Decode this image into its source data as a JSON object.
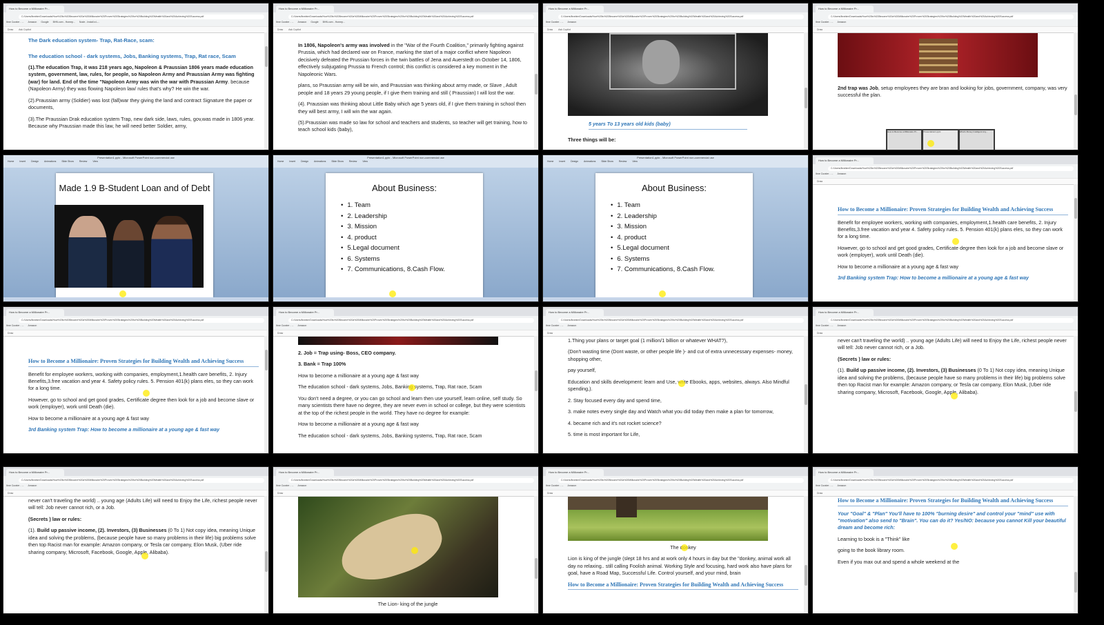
{
  "browser": {
    "tab_title": "How to Become a Millionaire Pr...",
    "address": "C:/Users/Ibrahim/Downloads/How%20to%20Become%20a%20Millionaire%20Proven%20Strategies%20for%20Building%20Wealth%20and%20Achieving%20Success.pdf",
    "bookmarks": [
      "Ibne Curater - ...",
      "Amazon",
      "Google",
      "BHN.com - Homep...",
      "Node - Install a L...",
      "Code Compile & R...",
      "Online PDF Conver...",
      "SiteMaster - Home...",
      "Fancy Portal Gove...",
      "The Rode Bay - The..."
    ],
    "toolbar": [
      "Draw",
      "Ask Copilot",
      "Edit with Acrobat"
    ],
    "other_favorites": "Other favorites"
  },
  "ppt": {
    "window_title": "Presentation1.pptx - Microsoft PowerPoint non-commercial use",
    "menu": [
      "Home",
      "Insert",
      "Design",
      "Animations",
      "Slide Show",
      "Review",
      "View"
    ],
    "status": "Office Theme"
  },
  "tiles": {
    "t1": {
      "h1": "The Dark education system- Trap, Rat-Race, scam:",
      "h2": "The education school - dark systems, Jobs, Banking systems, Trap, Rat race, Scam",
      "p1_bold": "(1).The education Trap, it was  218 years ago, Napoleon & Praussian 1806 years made education system, government, law, rules, for people, so Napoleon Army and Praussian Army was fighting (war) for land. End of the time \"Napoleon Army was win the war with Praussian Army",
      "p1_rest": ". because (Napoleon Army) they was flowing Napoleon law/ rules that's why? He win the war.",
      "p2": "(2).Praussian army (Soldier)  was lost (fall)war they  giving the land and contract Signature the paper or documents,",
      "p3": "(3).The Praussian Drak education system Trap, new dark side, laws, rules, gov,was made in 1806 year. Because why Praussian made this law, he will need better Soldier, army,"
    },
    "t2": {
      "p1_bold": "In 1806, Napoleon's army was involved",
      "p1_rest": " in the \"War of the Fourth Coalition,\" primarily fighting against Prussia, which had declared war on France, marking the start of a major conflict where Napoleon decisively defeated the Prussian forces in the twin battles of Jena and Auerstedt on October 14, 1806, effectively subjugating Prussia to French control; this conflict is considered a key moment in the Napoleonic Wars.",
      "p2": "plans, so Praussian army will be win, and Praussian was thinking about army made, or Slave , Adult people and 18 years 29 young people, if I give them training and still ( Praussian) I will lost the war.",
      "p3": "(4). Praussian was thinking about Little Baby which age 5 years old, if I give them training in school then they will best army, I will win the war again.",
      "p4": "(5).Praussian was made so law for school and teachers and students, so teacher will get training, how to teach school kids (baby),"
    },
    "t3": {
      "caption": "5 years To 13 years old kids (baby)",
      "p1": "Three things will be:"
    },
    "t4": {
      "p1_bold": "2nd trap was Job",
      "p1_rest": ", setup employees they are bran and looking for jobs, government, company, was very successful the plan.",
      "thumbs": [
        "How to Become a Millionaire Pr...",
        "Presentation1.pptx",
        "What's Money Intelligent Any..."
      ]
    },
    "t5": {
      "title": "Made 1.9 B-Student Loan and of Debt"
    },
    "t6": {
      "title": "About Business:",
      "items": [
        "1. Team",
        "2. Leadership",
        "3. Mission",
        "4. product",
        "5.Legal document",
        "6. Systems",
        "7. Communications, 8.Cash Flow."
      ]
    },
    "t8": {
      "heading": "How to Become a Millionaire: Proven Strategies for Building Wealth and Achieving Success",
      "p1": "Benefit for employee workers, working with companies, employment,1.health care benefits, 2. Injury Benefits,3.free vacation and year 4. Safety policy rules. 5. Pension 401(k) plans eles, so they can work for a long time.",
      "p2": "However, go to school and get good grades, Certificate degree then look for a job and become slave or work (employer), work until Death (die).",
      "p3": "How to become a millionaire at a young age & fast way",
      "p4": "3rd Banking system Trap: How to become a millionaire at a young age & fast way"
    },
    "t10": {
      "p1": "2. Job = Trap using- Boss, CEO company.",
      "p2": "3. Bank = Trap 100%",
      "p3": "How to become a millionaire at a young age & fast way",
      "p4": "The education school - dark systems, Jobs, Banking systems, Trap, Rat race, Scam",
      "p5": "You don't need a degree, or you can go school and learn then use yourself, learn online, self study. So many scientists there have no degree, they are never even in school or college, but they were scientists at the top of the richest people in the world. They have no degree for example:",
      "p6": "How to become a millionaire at a young age & fast way",
      "p7": "The education school - dark systems, Jobs, Banking systems, Trap, Rat race, Scam"
    },
    "t11": {
      "p0": "1.Thing your plans or target goal (1 million/1 billion or whatever WHAT?),",
      "p1": "(Don't wasting time (Dont waste, or other people life )- and cut of extra unnecessary expenses- money, shopping  other,",
      "p2": "pay yourself,",
      "p3": "Education and skills development: learn and Use, write Ebooks, apps, websites, always. Also Mindful spending,).",
      "p4": "2. Stay focused every day and spend time,",
      "p5": "3. make notes  every single day and Watch what you  did today then make a plan for tomorrow,",
      "p6": "4. became rich and it's not rocket science?",
      "p7": "5. time is most important for Life,"
    },
    "t12": {
      "p0": "never can't traveling the world) .. young age (Adults Life) will need to Enjoy  the Life, richest people never will tell: Job never cannot rich, or a Job.",
      "p1": "(Secrets ) law or rules:",
      "p2_a": " (1). ",
      "p2_b": "Build up passive income, (2). Investors, (3) Businesses",
      "p2_c": " (0 To 1) Not copy idea, meaning Unique idea and solving the problems, (because people have so many problems in their life) big problems solve then top Racist man for example: Amazon company, or Tesla car company, Elon Musk, (Uber ride sharing company, Microsoft, Facebook, Google, Apple, Alibaba)."
    },
    "t14": {
      "caption": "The Lion- king of the jungle"
    },
    "t15": {
      "caption": "The donkey",
      "p1": "Lion is king of the jungle (slept 18 hrs and at work only 4 hours in day but the \"donkey, animal work all day no relaxing.. still calling Foolish animal. Working Style and focusing, hard work also have plans for goal, have a Road Map, Successful Life. Control yourself, and your mind, brain",
      "heading": "How to Become a Millionaire: Proven Strategies for Building Wealth and Achieving Success"
    },
    "t16": {
      "heading": "How to Become a Millionaire: Proven Strategies for Building Wealth and Achieving Success",
      "quote": "Your \"Goal\" & \"Plan\" You'll have to  100%  \"burning desire\" and control your \"mind\" use with \"motivation\"  also send to \"Brain\". You can do it? Yes/NO: because you cannot Kill your beautiful dream and become rich:",
      "p1": "Learning to book is a \"Think\" like",
      "p2": "going to the book library room.",
      "p3": "Even if you max out and spend a whole weekend at the"
    }
  }
}
